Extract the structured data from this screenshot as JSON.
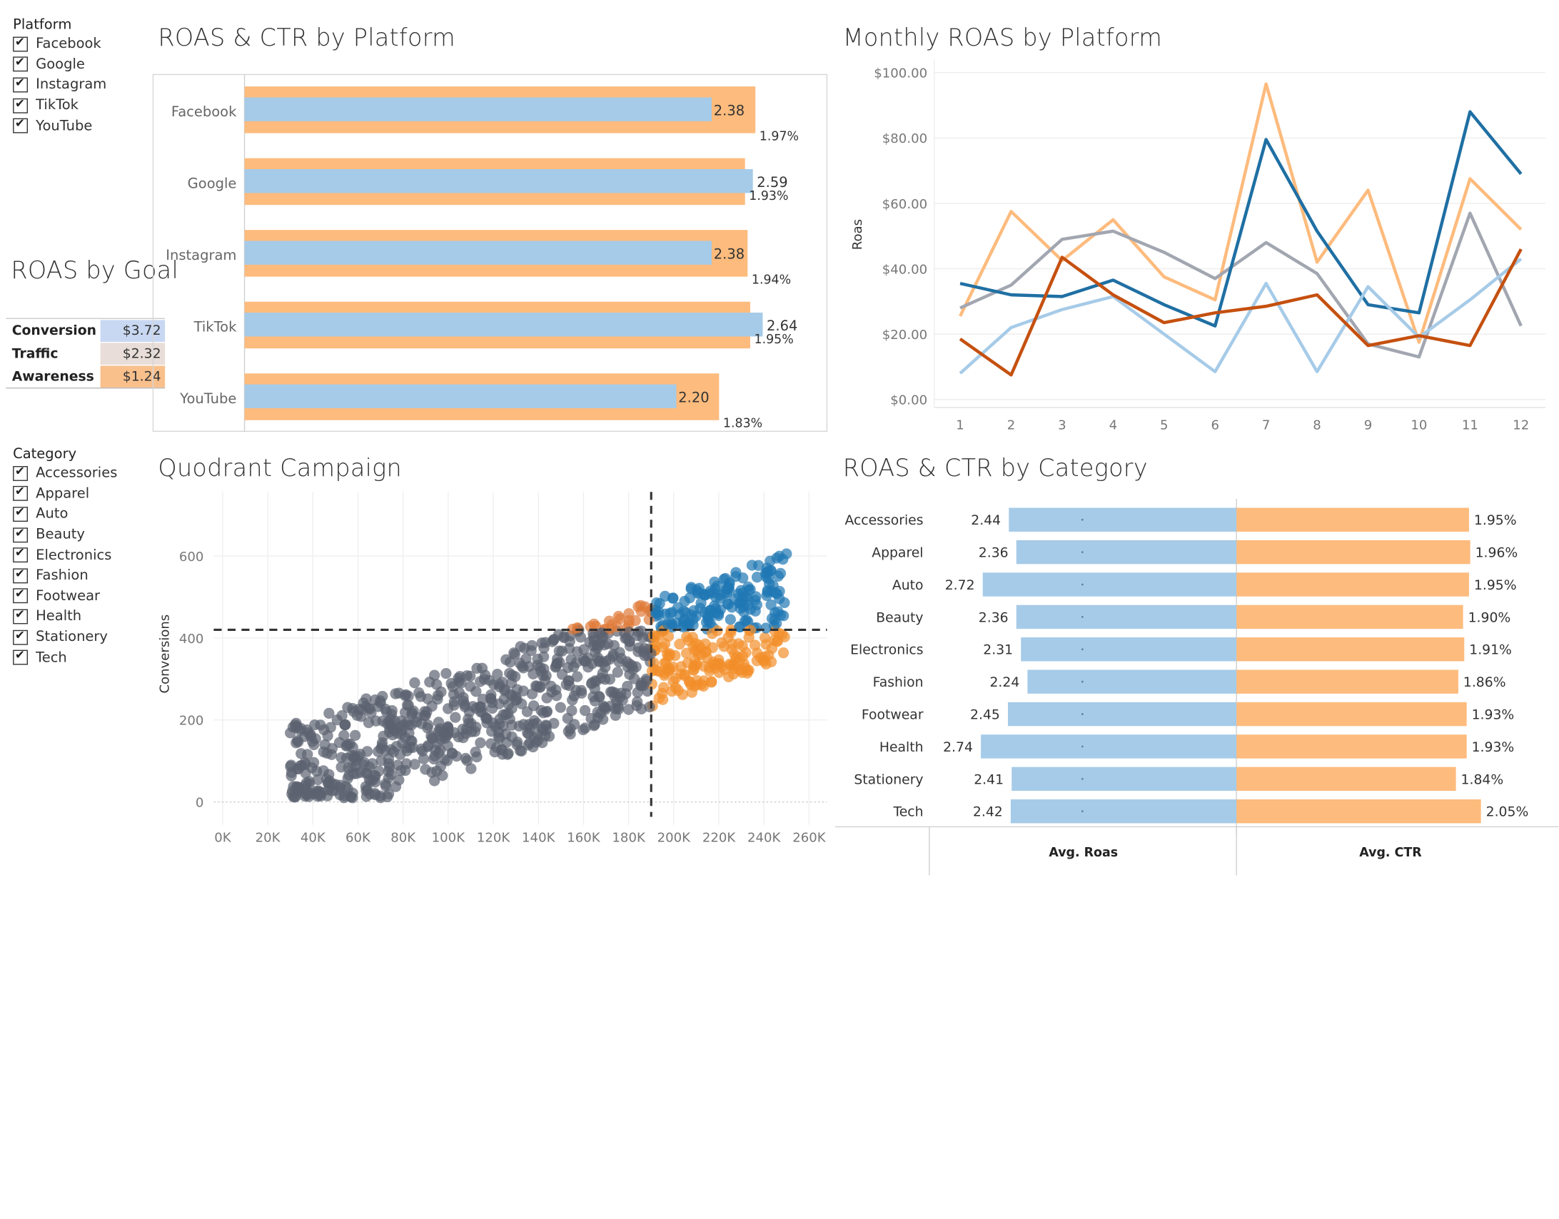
{
  "platform_filter": {
    "title": "Platform",
    "items": [
      "Facebook",
      "Google",
      "Instagram",
      "TikTok",
      "YouTube"
    ]
  },
  "category_filter": {
    "title": "Category",
    "items": [
      "Accessories",
      "Apparel",
      "Auto",
      "Beauty",
      "Electronics",
      "Fashion",
      "Footwear",
      "Health",
      "Stationery",
      "Tech"
    ]
  },
  "roas_by_goal": {
    "title": "ROAS by Goal",
    "rows": [
      {
        "label": "Conversion",
        "value": "$3.72",
        "color": "#c9d8f2"
      },
      {
        "label": "Traffic",
        "value": "$2.32",
        "color": "#e8ddd8"
      },
      {
        "label": "Awareness",
        "value": "$1.24",
        "color": "#f9c08c"
      }
    ]
  },
  "colors": {
    "blue_light": "#a6cbe8",
    "orange_light": "#fdbb7d",
    "blue_dark": "#1f6fa3",
    "orange_dark": "#c5500f",
    "grey": "#a2a6b0",
    "scatter_grey": "#5c6370",
    "scatter_orange": "#f28e2b",
    "scatter_blue": "#1f77b4",
    "scatter_mid_orange": "#e07b39"
  },
  "charts": {
    "platform": {
      "title": "ROAS & CTR by Platform",
      "chart_data": {
        "type": "bar",
        "categories": [
          "Facebook",
          "Google",
          "Instagram",
          "TikTok",
          "YouTube"
        ],
        "series": [
          {
            "name": "Avg. Roas",
            "values": [
              2.38,
              2.59,
              2.38,
              2.64,
              2.2
            ],
            "labels": [
              "2.38",
              "2.59",
              "2.38",
              "2.64",
              "2.20"
            ]
          },
          {
            "name": "Avg. CTR",
            "values": [
              1.97,
              1.93,
              1.94,
              1.95,
              1.83
            ],
            "labels": [
              "1.97%",
              "1.93%",
              "1.94%",
              "1.95%",
              "1.83%"
            ]
          }
        ]
      }
    },
    "monthly": {
      "title": "Monthly ROAS by Platform",
      "chart_data": {
        "type": "line",
        "x": [
          1,
          2,
          3,
          4,
          5,
          6,
          7,
          8,
          9,
          10,
          11,
          12
        ],
        "ylabel": "Roas",
        "ylim": [
          0,
          100
        ],
        "yticks": [
          "$0.00",
          "$20.00",
          "$40.00",
          "$60.00",
          "$80.00",
          "$100.00"
        ],
        "series": [
          {
            "color": "#fdbb7d",
            "values": [
              25.5,
              57.5,
              42.5,
              55.0,
              37.5,
              30.5,
              96.5,
              42.0,
              64.0,
              17.5,
              67.5,
              52.0
            ]
          },
          {
            "color": "#a2a6b0",
            "values": [
              28.0,
              35.0,
              49.0,
              51.5,
              45.0,
              37.0,
              48.0,
              38.5,
              17.0,
              13.0,
              57.0,
              22.5
            ]
          },
          {
            "color": "#1f6fa3",
            "values": [
              35.5,
              32.0,
              31.5,
              36.5,
              29.0,
              22.5,
              79.5,
              51.5,
              29.0,
              26.5,
              88.0,
              69.0
            ]
          },
          {
            "color": "#a6cbe8",
            "values": [
              8.0,
              22.0,
              27.5,
              31.5,
              20.0,
              8.5,
              35.5,
              8.5,
              34.5,
              19.0,
              30.5,
              43.0
            ]
          },
          {
            "color": "#c5500f",
            "values": [
              18.5,
              7.5,
              43.5,
              32.0,
              23.5,
              26.5,
              28.5,
              32.0,
              16.5,
              19.5,
              16.5,
              46.0
            ]
          }
        ]
      }
    },
    "quadrant": {
      "title": "Quodrant Campaign",
      "chart_data": {
        "type": "scatter",
        "ylabel": "Conversions",
        "xlim": [
          0,
          260000
        ],
        "ylim": [
          -40,
          700
        ],
        "xticks": [
          "0K",
          "20K",
          "40K",
          "60K",
          "80K",
          "100K",
          "120K",
          "140K",
          "160K",
          "180K",
          "200K",
          "220K",
          "240K",
          "260K"
        ],
        "yticks": [
          "0",
          "200",
          "400",
          "600"
        ],
        "ref_lines": {
          "x": 190000,
          "y": 420
        }
      }
    },
    "category": {
      "title": "ROAS & CTR by Category",
      "chart_data": {
        "type": "bar",
        "categories": [
          "Accessories",
          "Apparel",
          "Auto",
          "Beauty",
          "Electronics",
          "Fashion",
          "Footwear",
          "Health",
          "Stationery",
          "Tech"
        ],
        "series": [
          {
            "name": "Avg. Roas",
            "values": [
              2.44,
              2.36,
              2.72,
              2.36,
              2.31,
              2.24,
              2.45,
              2.74,
              2.41,
              2.42
            ],
            "labels": [
              "2.44",
              "2.36",
              "2.72",
              "2.36",
              "2.31",
              "2.24",
              "2.45",
              "2.74",
              "2.41",
              "2.42"
            ]
          },
          {
            "name": "Avg. CTR",
            "values": [
              1.95,
              1.96,
              1.95,
              1.9,
              1.91,
              1.86,
              1.93,
              1.93,
              1.84,
              2.05
            ],
            "labels": [
              "1.95%",
              "1.96%",
              "1.95%",
              "1.90%",
              "1.91%",
              "1.86%",
              "1.93%",
              "1.93%",
              "1.84%",
              "2.05%"
            ]
          }
        ],
        "axis_titles": [
          "Avg. Roas",
          "Avg. CTR"
        ]
      }
    }
  }
}
